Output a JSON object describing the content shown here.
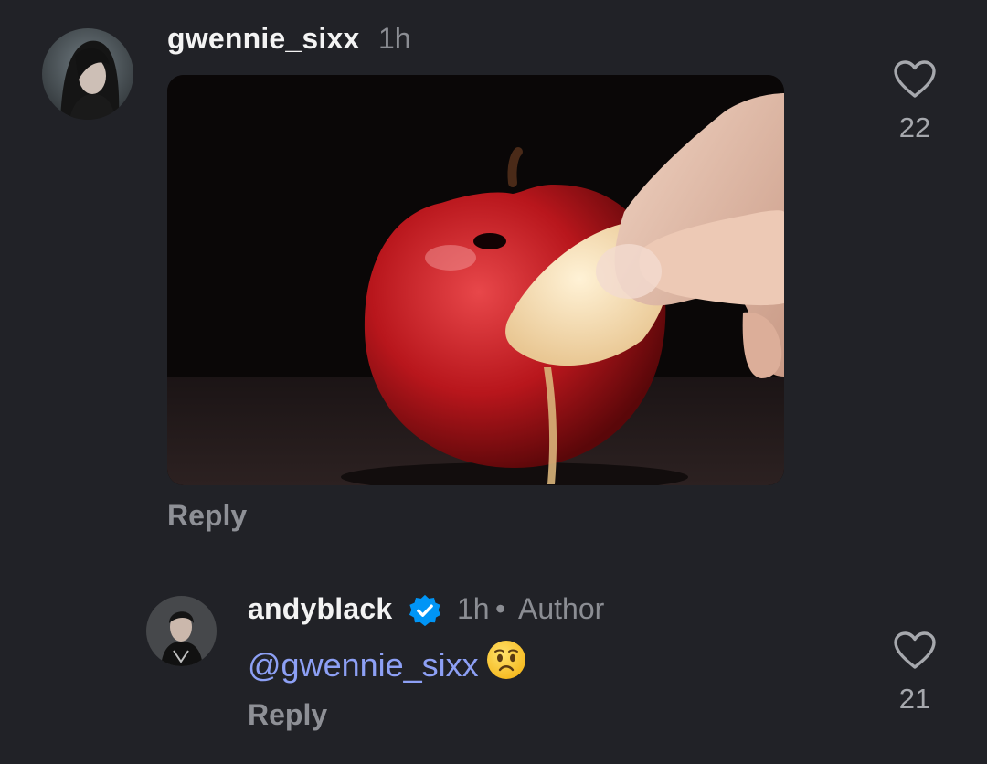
{
  "comments": [
    {
      "username": "gwennie_sixx",
      "time": "1h",
      "reply_label": "Reply",
      "likes": "22",
      "avatar_icon": "avatar-photo-icon",
      "media": "apple-gif-image"
    },
    {
      "username": "andyblack",
      "verified": true,
      "time": "1h",
      "separator": "•",
      "badge": "Author",
      "mention_prefix": "@",
      "mention": "gwennie_sixx",
      "emoji": "worried-face-emoji",
      "reply_label": "Reply",
      "likes": "21"
    }
  ],
  "colors": {
    "background": "#212227",
    "username": "#f3f3f3",
    "meta": "#8b8d93",
    "mention": "#8da0f5",
    "verified": "#0095f6"
  }
}
